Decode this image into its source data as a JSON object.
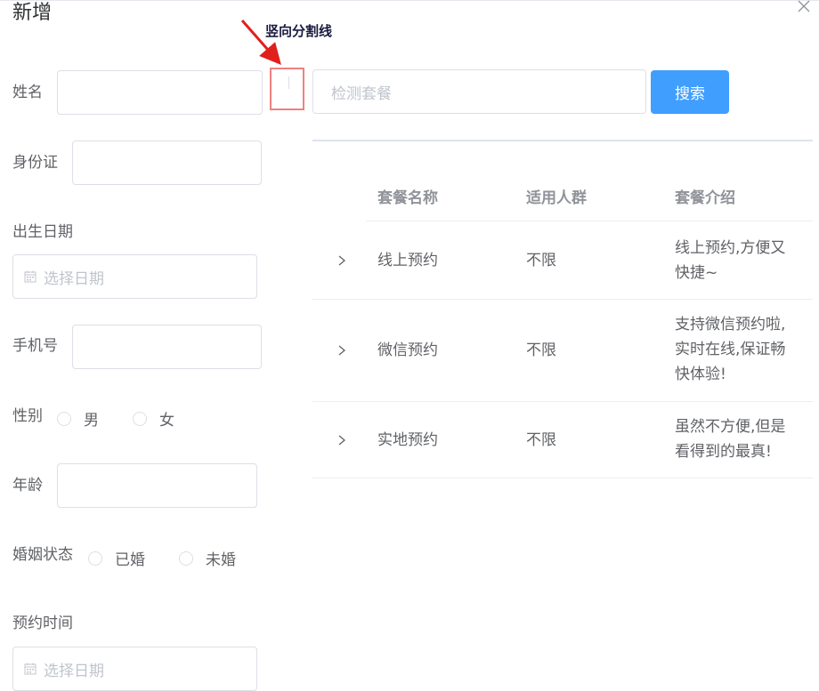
{
  "dialog": {
    "title": "新增"
  },
  "form": {
    "name_label": "姓名",
    "id_label": "身份证",
    "birth_label": "出生日期",
    "birth_placeholder": "选择日期",
    "phone_label": "手机号",
    "gender_label": "性别",
    "gender_options": [
      "男",
      "女"
    ],
    "age_label": "年龄",
    "marital_label": "婚姻状态",
    "marital_options": [
      "已婚",
      "未婚"
    ],
    "appointment_label": "预约时间",
    "appointment_placeholder": "选择日期"
  },
  "annotation": {
    "text": "竖向分割线"
  },
  "search": {
    "placeholder": "检测套餐",
    "button_label": "搜索"
  },
  "table": {
    "headers": [
      "套餐名称",
      "适用人群",
      "套餐介绍"
    ],
    "rows": [
      {
        "name": "线上预约",
        "group": "不限",
        "intro_lines": [
          "线上预约,方便又",
          "快捷~"
        ]
      },
      {
        "name": "微信预约",
        "group": "不限",
        "intro_lines": [
          "支持微信预约啦,",
          "实时在线,保证畅",
          "快体验!"
        ]
      },
      {
        "name": "实地预约",
        "group": "不限",
        "intro_lines": [
          "虽然不方便,但是",
          "看得到的最真!"
        ]
      }
    ]
  },
  "colors": {
    "primary": "#409eff",
    "highlight": "#f08080",
    "arrow": "#e0201c"
  }
}
